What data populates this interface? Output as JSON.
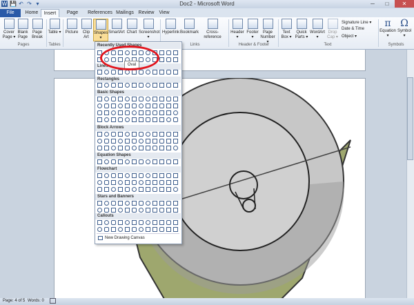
{
  "window": {
    "title": "Doc2 - Microsoft Word",
    "minimize": "─",
    "maximize": "□",
    "close": "✕"
  },
  "quick_access": [
    "W",
    "💾",
    "↶",
    "↷",
    "▾"
  ],
  "tabs": [
    "File",
    "Home",
    "Insert",
    "Page Layout",
    "References",
    "Mailings",
    "Review",
    "View"
  ],
  "ribbon": {
    "pages": [
      "Cover Page ▾",
      "Blank Page",
      "Page Break"
    ],
    "tables": [
      "Table ▾"
    ],
    "illustrations": [
      "Picture",
      "Clip Art",
      "Shapes ▾",
      "SmartArt",
      "Chart",
      "Screenshot ▾"
    ],
    "links": [
      "Hyperlink",
      "Bookmark",
      "Cross-reference"
    ],
    "header_footer": [
      "Header ▾",
      "Footer ▾",
      "Page Number ▾"
    ],
    "text": [
      "Text Box ▾",
      "Quick Parts ▾",
      "WordArt ▾",
      "Drop Cap ▾"
    ],
    "text_small": [
      "Signature Line ▾",
      "Date & Time",
      "Object ▾"
    ],
    "symbols": [
      "Equation ▾",
      "Symbol ▾"
    ],
    "symbol_glyphs": [
      "π",
      "Ω"
    ],
    "group_labels": [
      "Pages",
      "Tables",
      "Links",
      "Header & Footer",
      "Text",
      "Symbols"
    ]
  },
  "gallery": {
    "sections": [
      "Recently Used Shapes",
      "Lines",
      "Rectangles",
      "Basic Shapes",
      "Block Arrows",
      "Equation Shapes",
      "Flowchart",
      "Stars and Banners",
      "Callouts"
    ],
    "tooltip": "Oval",
    "footer": "New Drawing Canvas"
  },
  "status": {
    "page": "Page: 4 of 5",
    "words": "Words: 0"
  },
  "colors": {
    "accent": "#2a5aa8",
    "highlight": "#e2141c",
    "olive": "#7d8a3e"
  }
}
